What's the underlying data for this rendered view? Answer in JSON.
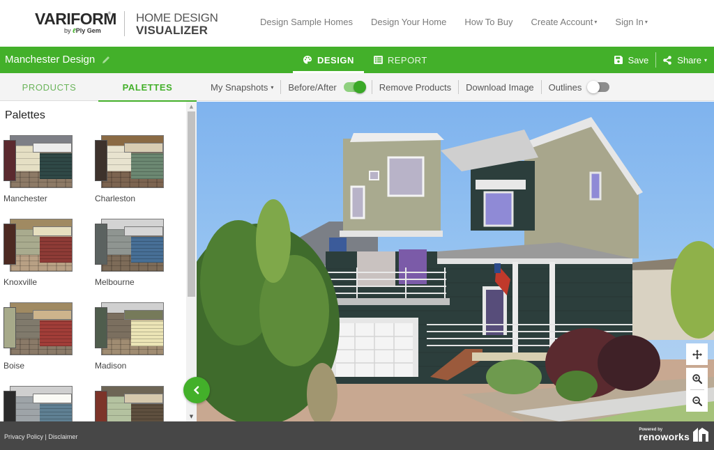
{
  "header": {
    "brand": "VARIFORM",
    "brand_mark": "®",
    "brand_by": "by",
    "brand_parent": "Ply Gem",
    "product_line1": "HOME DESIGN",
    "product_line2": "VISUALIZER",
    "nav": [
      {
        "label": "Design Sample Homes",
        "dropdown": false
      },
      {
        "label": "Design Your Home",
        "dropdown": false
      },
      {
        "label": "How To Buy",
        "dropdown": false
      },
      {
        "label": "Create Account",
        "dropdown": true
      },
      {
        "label": "Sign In",
        "dropdown": true
      }
    ],
    "caret": "▾"
  },
  "greenbar": {
    "design_name": "Manchester Design",
    "tabs": [
      {
        "label": "DESIGN",
        "icon": "palette-icon",
        "active": true
      },
      {
        "label": "REPORT",
        "icon": "list-icon",
        "active": false
      }
    ],
    "save_label": "Save",
    "share_label": "Share",
    "accent_color": "#43b02a"
  },
  "subbar": {
    "side_tabs": [
      {
        "label": "PRODUCTS",
        "active": false
      },
      {
        "label": "PALETTES",
        "active": true
      }
    ],
    "snapshots_label": "My Snapshots",
    "before_after_label": "Before/After",
    "before_after_on": true,
    "remove_products_label": "Remove Products",
    "download_image_label": "Download Image",
    "outlines_label": "Outlines",
    "outlines_on": false
  },
  "sidebar": {
    "title": "Palettes",
    "palettes": [
      {
        "name": "Manchester",
        "colors": {
          "roof": "#7d7f86",
          "shutter": "#5b2a2f",
          "trim": "#ececec",
          "shake": "#e5dfc4",
          "siding": "#2f4846",
          "stone": "#8d7a66"
        }
      },
      {
        "name": "Charleston",
        "colors": {
          "roof": "#8a6a44",
          "shutter": "#3d322c",
          "trim": "#d9cdb3",
          "shake": "#e8e3cf",
          "siding": "#6c8872",
          "stone": "#7c6450"
        }
      },
      {
        "name": "Knoxville",
        "colors": {
          "roof": "#a08a62",
          "shutter": "#4d2a22",
          "trim": "#e6dfbf",
          "shake": "#a9ab8e",
          "siding": "#8e3b36",
          "stone": "#b8a084"
        }
      },
      {
        "name": "Melbourne",
        "colors": {
          "roof": "#d3d3d3",
          "shutter": "#5b6260",
          "trim": "#d6d6d6",
          "shake": "#8f9591",
          "siding": "#476f96",
          "stone": "#7d6b58"
        }
      },
      {
        "name": "Boise",
        "colors": {
          "roof": "#a08a62",
          "shutter": "#a7aa8a",
          "trim": "#cdb48c",
          "shake": "#807a6c",
          "siding": "#a13d38",
          "stone": "#8a7a68"
        }
      },
      {
        "name": "Madison",
        "colors": {
          "roof": "#d0d0d0",
          "shutter": "#4f5d4d",
          "trim": "#767a5a",
          "shake": "#7b6f5f",
          "siding": "#ece5b6",
          "stone": "#a08c72"
        }
      },
      {
        "name": "",
        "colors": {
          "roof": "#cfcfcf",
          "shutter": "#2b2b2b",
          "trim": "#fafaf5",
          "shake": "#9ea4a8",
          "siding": "#5f8093",
          "stone": "#888888"
        }
      },
      {
        "name": "",
        "colors": {
          "roof": "#6d6555",
          "shutter": "#7c3429",
          "trim": "#d6c9ad",
          "shake": "#b4c2a0",
          "siding": "#5e4f3e",
          "stone": "#777777"
        }
      }
    ]
  },
  "canvas": {
    "controls": [
      "move-icon",
      "zoom-in-icon",
      "zoom-out-icon"
    ]
  },
  "footer": {
    "privacy": "Privacy Policy",
    "separator": "|",
    "disclaimer": "Disclaimer",
    "powered_by": "Powered by",
    "powered_brand": "renoworks"
  }
}
